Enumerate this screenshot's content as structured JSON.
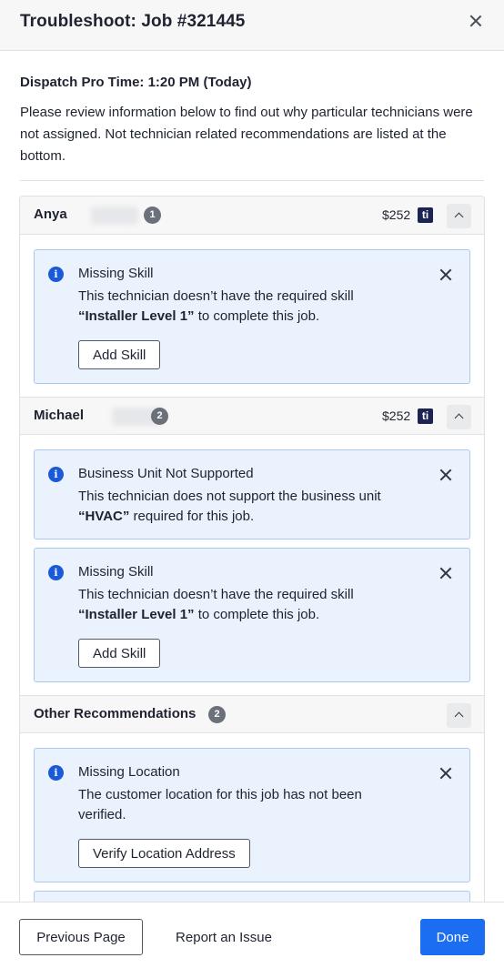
{
  "header": {
    "title": "Troubleshoot: Job #321445",
    "close_icon": "close-icon"
  },
  "dispatch_time": "Dispatch Pro Time: 1:20 PM (Today)",
  "description": "Please review information below to find out why particular technicians were not assigned. Not technician related recommendations are listed at the bottom.",
  "technicians": [
    {
      "name": "Anya",
      "surname_redacted": true,
      "count": "1",
      "price": "$252",
      "logo": "ti",
      "issues": [
        {
          "title": "Missing Skill",
          "message_prefix": "This technician doesn’t have the required skill ",
          "message_bold": "“Installer Level 1”",
          "message_suffix": " to complete this job.",
          "button": "Add Skill"
        }
      ]
    },
    {
      "name": "Michael",
      "surname_redacted": true,
      "count": "2",
      "price": "$252",
      "logo": "ti",
      "issues": [
        {
          "title": "Business Unit Not Supported",
          "message_prefix": "This technician does not support the business unit ",
          "message_bold": "“HVAC”",
          "message_suffix": " required for this job."
        },
        {
          "title": "Missing Skill",
          "message_prefix": "This technician doesn’t have the required skill ",
          "message_bold": "“Installer Level 1”",
          "message_suffix": " to complete this job.",
          "button": "Add Skill"
        }
      ]
    }
  ],
  "other": {
    "title": "Other Recommendations",
    "count": "2",
    "issues": [
      {
        "title": "Missing Location",
        "message": "The customer location for this job has not been verified.",
        "button": "Verify Location Address"
      }
    ]
  },
  "footer": {
    "previous": "Previous Page",
    "report": "Report an Issue",
    "done": "Done"
  },
  "colors": {
    "accent": "#1b6ef2",
    "alert_bg": "#e9f2fd",
    "alert_border": "#a9c9f2",
    "info_icon": "#1a5ad8",
    "logo_bg": "#1b2453"
  }
}
